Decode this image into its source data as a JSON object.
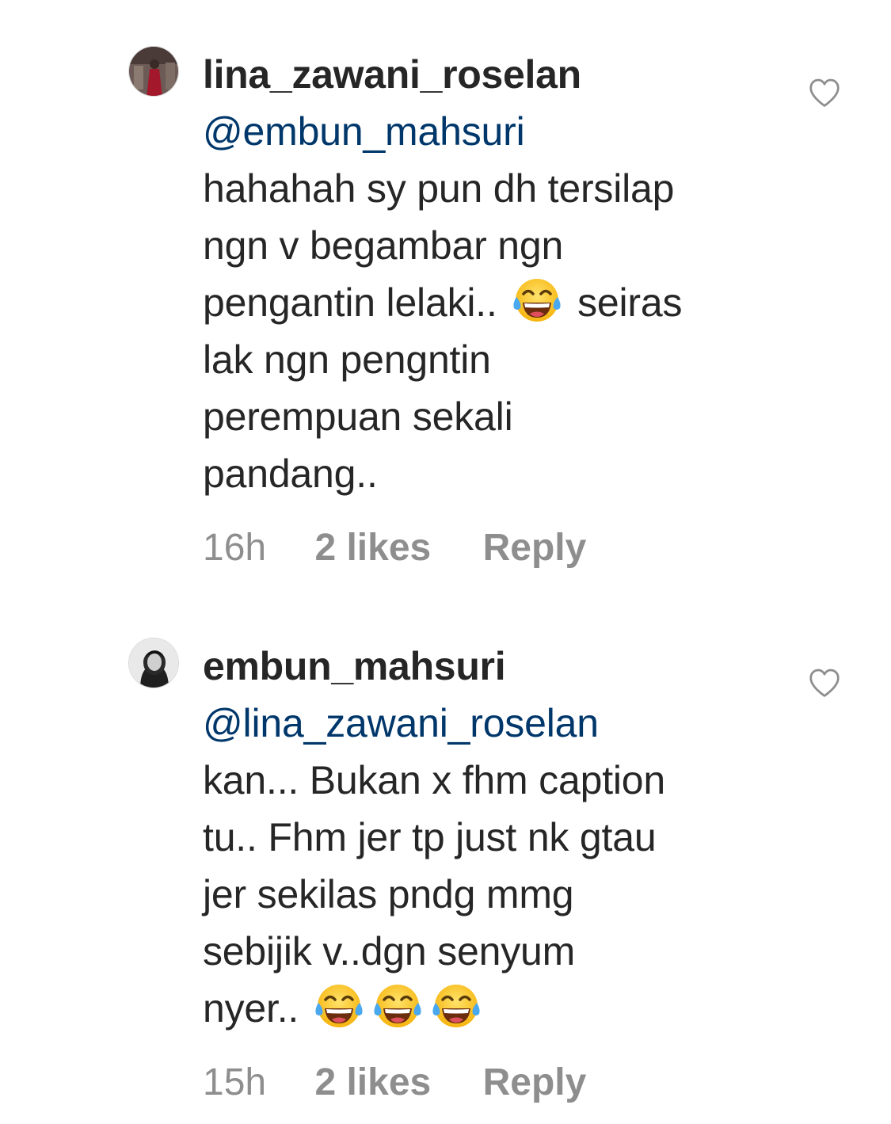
{
  "comments": [
    {
      "username": "lina_zawani_roselan",
      "mention": "@embun_mahsuri",
      "lines": [
        "hahahah sy pun dh tersilap",
        "ngn v begambar ngn",
        [
          "pengantin lelaki.. ",
          "emoji",
          " seiras"
        ],
        "lak ngn pengntin",
        "perempuan sekali",
        "pandang.."
      ],
      "time": "16h",
      "likes": "2 likes",
      "reply": "Reply"
    },
    {
      "username": "embun_mahsuri",
      "mention": "@lina_zawani_roselan",
      "lines": [
        "kan... Bukan x fhm caption",
        "tu.. Fhm jer tp just nk gtau",
        "jer sekilas pndg mmg",
        "sebijik v..dgn senyum",
        [
          "nyer.. ",
          "emoji",
          "emoji",
          "emoji"
        ]
      ],
      "time": "15h",
      "likes": "2 likes",
      "reply": "Reply"
    }
  ],
  "colors": {
    "text": "#262626",
    "mention": "#00376b",
    "secondary": "#8e8e8e",
    "heart": "#8e8e8e"
  },
  "icons": {
    "like": "heart-outline-icon",
    "emoji": "face-with-tears-of-joy"
  }
}
